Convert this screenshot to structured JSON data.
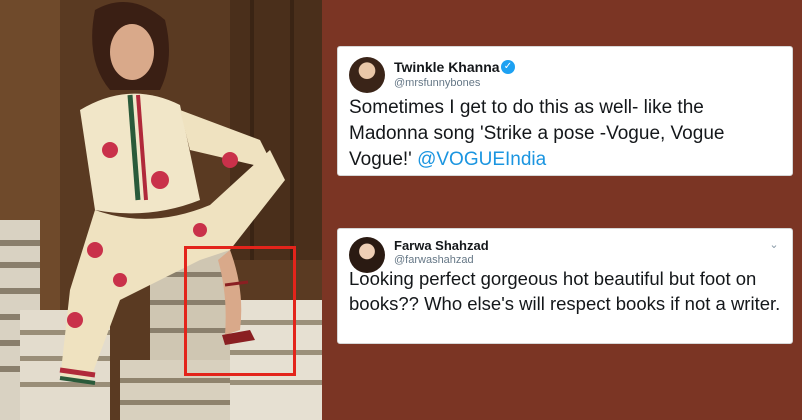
{
  "tweets": [
    {
      "name": "Twinkle Khanna",
      "handle": "@mrsfunnybones",
      "verified": true,
      "text": "Sometimes I get to do this as well- like the Madonna song 'Strike a pose -Vogue, Vogue Vogue!' ",
      "mention": "@VOGUEIndia"
    },
    {
      "name": "Farwa Shahzad",
      "handle": "@farwashahzad",
      "text": "Looking perfect  gorgeous hot beautiful but foot on books?? Who else's will respect books if not a writer."
    }
  ],
  "icons": {
    "verified": "verified-badge-icon",
    "menu": "chevron-down-icon"
  },
  "colors": {
    "background": "#7b3524",
    "highlight_box": "#e3241b",
    "link": "#1b95e0",
    "verified": "#1da1f2"
  }
}
